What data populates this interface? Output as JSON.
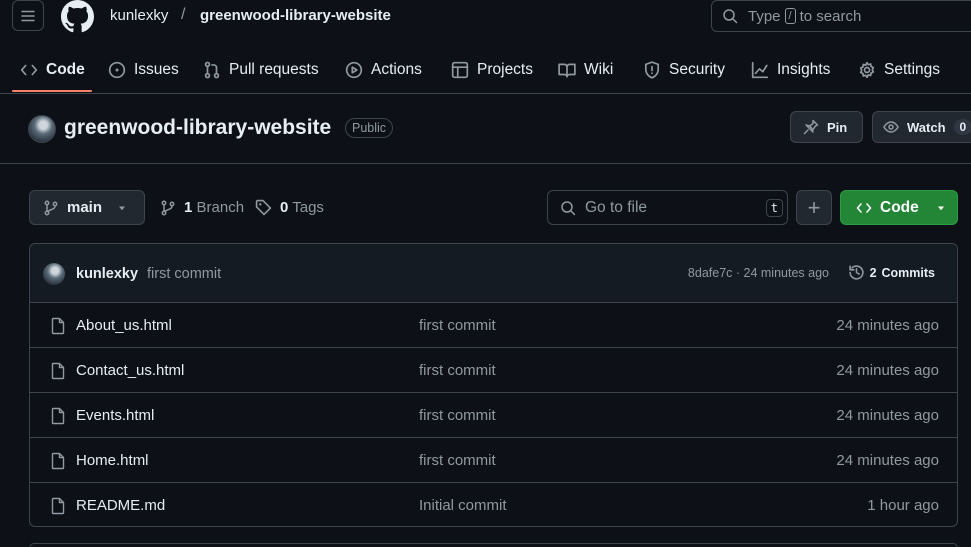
{
  "header": {
    "owner": "kunlexky",
    "separator": "/",
    "repo": "greenwood-library-website",
    "search": {
      "prefix": "Type",
      "key": "/",
      "suffix": "to search"
    }
  },
  "tabs": [
    {
      "label": "Code",
      "icon": "code-icon",
      "active": true
    },
    {
      "label": "Issues",
      "icon": "issue-icon"
    },
    {
      "label": "Pull requests",
      "icon": "pull-request-icon"
    },
    {
      "label": "Actions",
      "icon": "play-icon"
    },
    {
      "label": "Projects",
      "icon": "table-icon"
    },
    {
      "label": "Wiki",
      "icon": "book-icon"
    },
    {
      "label": "Security",
      "icon": "shield-icon"
    },
    {
      "label": "Insights",
      "icon": "graph-icon"
    },
    {
      "label": "Settings",
      "icon": "gear-icon"
    }
  ],
  "repo": {
    "title": "greenwood-library-website",
    "visibility": "Public",
    "pin_label": "Pin",
    "watch_label": "Watch",
    "watch_count": "0"
  },
  "branch_bar": {
    "branch": "main",
    "branch_count": "1",
    "branch_label": "Branch",
    "tag_count": "0",
    "tag_label": "Tags",
    "goto_placeholder": "Go to file",
    "goto_key": "t",
    "plus": "+",
    "code_label": "Code"
  },
  "latest_commit": {
    "author": "kunlexky",
    "message": "first commit",
    "meta": "8dafe7c · 24 minutes ago",
    "commits_count": "2",
    "commits_label": "Commits"
  },
  "files": [
    {
      "name": "About_us.html",
      "message": "first commit",
      "time": "24 minutes ago"
    },
    {
      "name": "Contact_us.html",
      "message": "first commit",
      "time": "24 minutes ago"
    },
    {
      "name": "Events.html",
      "message": "first commit",
      "time": "24 minutes ago"
    },
    {
      "name": "Home.html",
      "message": "first commit",
      "time": "24 minutes ago"
    },
    {
      "name": "README.md",
      "message": "Initial commit",
      "time": "1 hour ago"
    }
  ],
  "colors": {
    "accent": "#f78166",
    "primary_button": "#238636",
    "background": "#0d1117"
  }
}
